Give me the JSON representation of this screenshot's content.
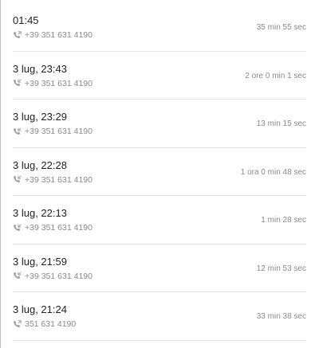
{
  "colors": {
    "primary_text": "#212121",
    "secondary_text": "#8a8a8a",
    "divider": "#e6e6e6",
    "icon": "#9e9e9e"
  },
  "calls": [
    {
      "time": "01:45",
      "number": "+39 351 631 4190",
      "duration": "35 min 55 sec",
      "direction_icon": "outgoing-call-icon"
    },
    {
      "time": "3 lug, 23:43",
      "number": "+39 351 631 4190",
      "duration": "2 ore 0 min 1 sec",
      "direction_icon": "incoming-call-icon"
    },
    {
      "time": "3 lug, 23:29",
      "number": "+39 351 631 4190",
      "duration": "13 min 15 sec",
      "direction_icon": "incoming-call-icon"
    },
    {
      "time": "3 lug, 22:28",
      "number": "+39 351 631 4190",
      "duration": "1 ora 0 min 48 sec",
      "direction_icon": "incoming-call-icon"
    },
    {
      "time": "3 lug, 22:13",
      "number": "+39 351 631 4190",
      "duration": "1 min 28 sec",
      "direction_icon": "incoming-call-icon"
    },
    {
      "time": "3 lug, 21:59",
      "number": "+39 351 631 4190",
      "duration": "12 min 53 sec",
      "direction_icon": "incoming-call-icon"
    },
    {
      "time": "3 lug, 21:24",
      "number": "351 631 4190",
      "duration": "33 min 38 sec",
      "direction_icon": "outgoing-call-icon"
    }
  ]
}
